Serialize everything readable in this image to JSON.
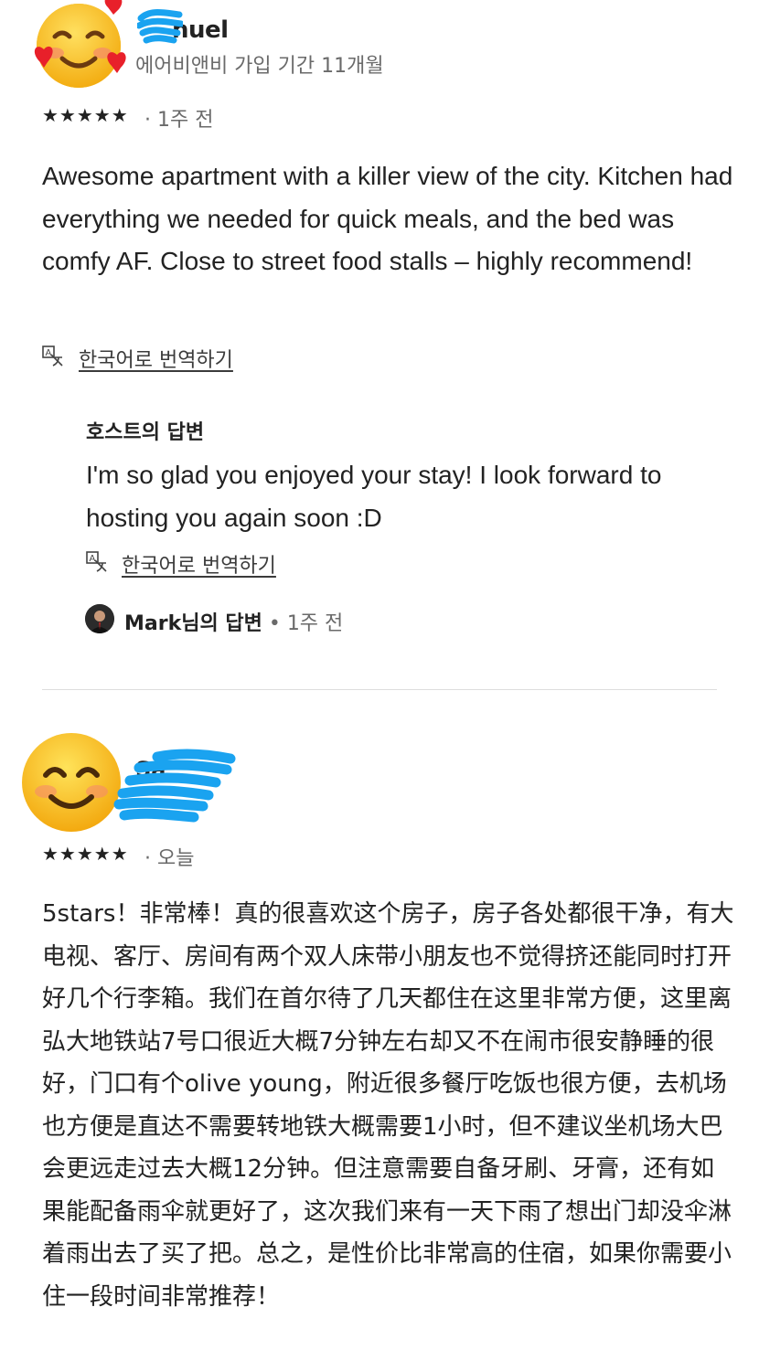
{
  "review1": {
    "reviewer_name": "nuel",
    "member_since": "에어비앤비 가입 기간 11개월",
    "stars": "★★★★★",
    "time": "· 1주 전",
    "text": "Awesome apartment with a killer view of the city. Kitchen had everything we needed for quick meals, and the bed was comfy AF. Close to street food stalls – highly recommend!",
    "translate_label": "한국어로 번역하기",
    "host_response": {
      "title": "호스트의 답변",
      "text": "I'm so glad you enjoyed your stay! I look forward to hosting you again soon :D",
      "translate_label": "한국어로 번역하기",
      "responder_name": "Mark님의 답변",
      "time": "• 1주 전"
    }
  },
  "review2": {
    "reviewer_name": "Sa",
    "stars": "★★★★★",
    "time": "· 오늘",
    "text": "5stars！非常棒！真的很喜欢这个房子，房子各处都很干净，有大电视、客厅、房间有两个双人床带小朋友也不觉得挤还能同时打开好几个行李箱。我们在首尔待了几天都住在这里非常方便，这里离弘大地铁站7号口很近大概7分钟左右却又不在闹市很安静睡的很好，门口有个olive young，附近很多餐厅吃饭也很方便，去机场也方便是直达不需要转地铁大概需要1小时，但不建议坐机场大巴会更远走过去大概12分钟。但注意需要自备牙刷、牙膏，还有如果能配备雨伞就更好了，这次我们来有一天下雨了想出门却没伞淋着雨出去了买了把。总之，是性价比非常高的住宿，如果你需要小住一段时间非常推荐！"
  },
  "icons": {
    "translate": "translate-icon",
    "avatar1": "smiling-face-with-hearts-emoji",
    "avatar2": "smiling-face-emoji"
  },
  "colors": {
    "redaction": "#1aa3f0",
    "text": "#222222",
    "muted": "#6a6a6a",
    "divider": "#dddddd"
  }
}
